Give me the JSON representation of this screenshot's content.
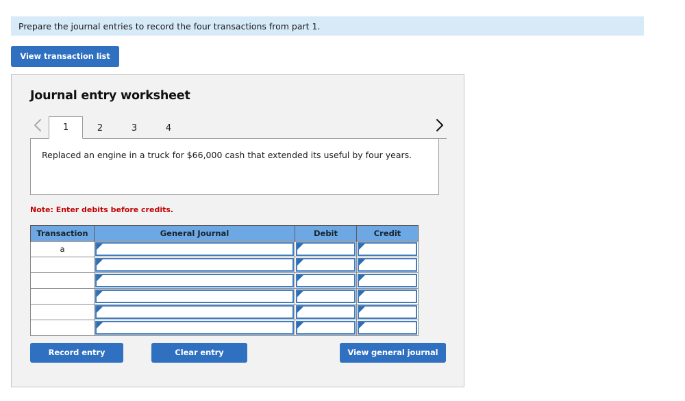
{
  "banner": {
    "text": "Prepare the journal entries to record the four transactions from part 1."
  },
  "toolbar": {
    "view_transaction_list_label": "View transaction list"
  },
  "worksheet": {
    "title": "Journal entry worksheet",
    "prev_icon": "chevron-left-icon",
    "next_icon": "chevron-right-icon",
    "tabs": [
      {
        "label": "1",
        "active": true
      },
      {
        "label": "2",
        "active": false
      },
      {
        "label": "3",
        "active": false
      },
      {
        "label": "4",
        "active": false
      }
    ],
    "description": "Replaced an engine in a truck for $66,000 cash that extended its useful by four years.",
    "note": "Note: Enter debits before credits."
  },
  "table": {
    "headers": [
      "Transaction",
      "General Journal",
      "Debit",
      "Credit"
    ],
    "rows": [
      {
        "transaction": "a",
        "general_journal": "",
        "debit": "",
        "credit": ""
      },
      {
        "transaction": "",
        "general_journal": "",
        "debit": "",
        "credit": ""
      },
      {
        "transaction": "",
        "general_journal": "",
        "debit": "",
        "credit": ""
      },
      {
        "transaction": "",
        "general_journal": "",
        "debit": "",
        "credit": ""
      },
      {
        "transaction": "",
        "general_journal": "",
        "debit": "",
        "credit": ""
      },
      {
        "transaction": "",
        "general_journal": "",
        "debit": "",
        "credit": ""
      }
    ]
  },
  "actions": {
    "record_entry_label": "Record entry",
    "clear_entry_label": "Clear entry",
    "view_general_journal_label": "View general journal"
  },
  "colors": {
    "banner_bg": "#d6eaf8",
    "button_blue": "#2f70c0",
    "table_header_blue": "#6ea8e4",
    "entry_border_blue": "#3f7cc0",
    "note_red": "#c00000",
    "panel_bg": "#f2f2f2"
  }
}
